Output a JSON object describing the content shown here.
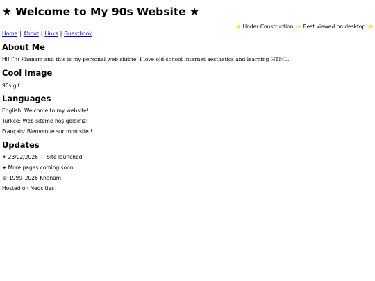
{
  "header": {
    "title": "★ Welcome to My 90s Website ★",
    "banner": "✨ Under Construction ✨ Best viewed on desktop ✨"
  },
  "nav": {
    "items": [
      {
        "label": "Home"
      },
      {
        "label": "About"
      },
      {
        "label": "Links"
      },
      {
        "label": "Guestbook"
      }
    ],
    "separator": "|"
  },
  "about": {
    "heading": "About Me",
    "text_before": "Hi! I'm ",
    "text_after": "Khanam and this is my personal web shrine. I love old-school internet aesthetics and learning HTML."
  },
  "image_section": {
    "heading": "Cool Image",
    "alt_text": "90s gif"
  },
  "languages": {
    "heading": "Languages",
    "items": [
      {
        "text": "English: Welcome to my website!"
      },
      {
        "text": "Türkçe: Web siteme hoş geldiniz!"
      },
      {
        "text": "Français: Bienvenue sur mon site !"
      }
    ]
  },
  "updates": {
    "heading": "Updates",
    "items": [
      {
        "text": "✦ 23/02/2026 — Site launched"
      },
      {
        "text": "✦ More pages coming soon"
      }
    ]
  },
  "footer": {
    "copyright": "© 1999–2026 Khanam",
    "hosted": "Hosted on Neocities"
  }
}
